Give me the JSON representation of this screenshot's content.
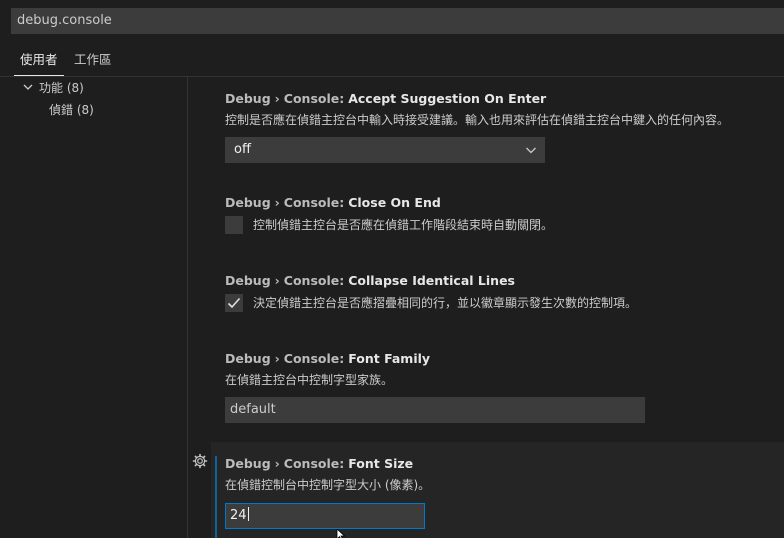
{
  "search": {
    "value": "debug.console"
  },
  "tabs": [
    {
      "label": "使用者"
    },
    {
      "label": "工作區"
    }
  ],
  "toc": {
    "features": {
      "label": "功能 (8)"
    },
    "debug": {
      "label": "偵錯 (8)"
    }
  },
  "settings": [
    {
      "category": "Debug",
      "separator": "›",
      "subcategory": "Console:",
      "name": "Accept Suggestion On Enter",
      "description": "控制是否應在偵錯主控台中輸入時接受建議。輸入也用來評估在偵錯主控台中鍵入的任何內容。",
      "value": "off"
    },
    {
      "category": "Debug",
      "separator": "›",
      "subcategory": "Console:",
      "name": "Close On End",
      "description": "控制偵錯主控台是否應在偵錯工作階段結束時自動關閉。",
      "checked": false
    },
    {
      "category": "Debug",
      "separator": "›",
      "subcategory": "Console:",
      "name": "Collapse Identical Lines",
      "description": "決定偵錯主控台是否應摺疊相同的行，並以徽章顯示發生次數的控制項。",
      "checked": true
    },
    {
      "category": "Debug",
      "separator": "›",
      "subcategory": "Console:",
      "name": "Font Family",
      "description": "在偵錯主控台中控制字型家族。",
      "value": "default"
    },
    {
      "category": "Debug",
      "separator": "›",
      "subcategory": "Console:",
      "name": "Font Size",
      "description": "在偵錯控制台中控制字型大小 (像素)。",
      "value": "24"
    }
  ],
  "colors": {
    "background": "#1e1e1e",
    "input_background": "#3c3c3c",
    "focus_border": "#007acc",
    "focus_bar": "#0e639c"
  },
  "icons": {
    "chevron": "chevron-down-icon",
    "gear": "gear-icon",
    "check": "check-icon",
    "cursor": "mouse-cursor-icon"
  }
}
